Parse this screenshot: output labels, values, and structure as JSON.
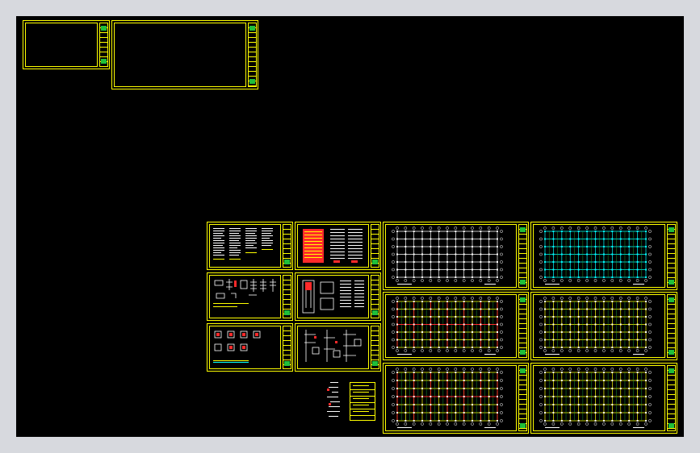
{
  "app": {
    "name": "",
    "background_color": "#d7d9de",
    "model_space_color": "#000000"
  },
  "colors": {
    "frame": "#ffff00",
    "axis": "#00ffff",
    "beam_red": "#ff2a2a",
    "title_logo": "#1fbf3a",
    "detail_white": "#ffffff"
  },
  "sheets": [
    {
      "id": "blank-a",
      "kind": "blank"
    },
    {
      "id": "blank-b",
      "kind": "blank"
    },
    {
      "id": "notes-1",
      "kind": "notes"
    },
    {
      "id": "notes-2",
      "kind": "notes-table"
    },
    {
      "id": "plan-1",
      "kind": "grid-plan"
    },
    {
      "id": "plan-2",
      "kind": "grid-plan-cyan"
    },
    {
      "id": "details-1",
      "kind": "details"
    },
    {
      "id": "details-2",
      "kind": "details"
    },
    {
      "id": "plan-3",
      "kind": "grid-plan-red"
    },
    {
      "id": "plan-4",
      "kind": "grid-plan-yellow"
    },
    {
      "id": "details-3",
      "kind": "details"
    },
    {
      "id": "details-4",
      "kind": "details"
    },
    {
      "id": "plan-5",
      "kind": "grid-plan-red"
    },
    {
      "id": "plan-6",
      "kind": "grid-plan-yellow"
    },
    {
      "id": "legend",
      "kind": "legend"
    }
  ]
}
